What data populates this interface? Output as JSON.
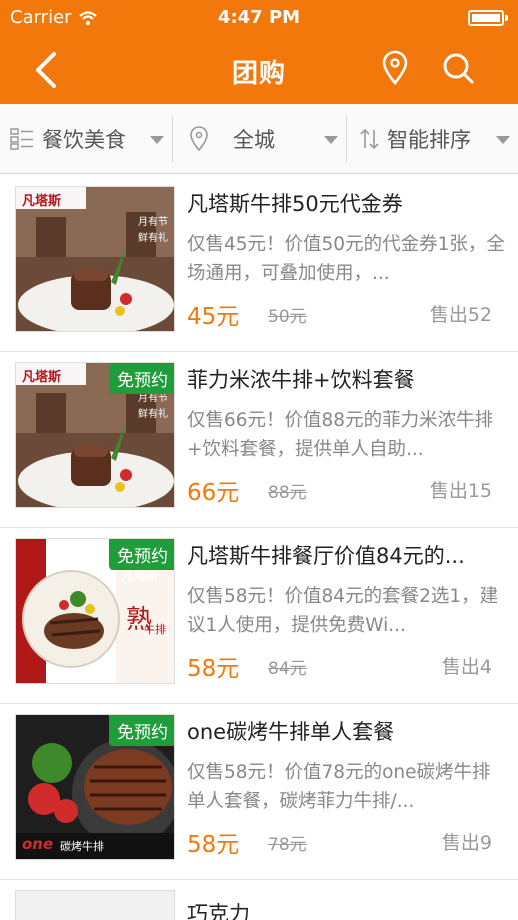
{
  "status": {
    "carrier": "Carrier",
    "time": "4:47 PM"
  },
  "nav": {
    "title": "团购",
    "back_icon": "chevron-left-icon",
    "location_icon": "location-pin-icon",
    "search_icon": "search-icon"
  },
  "filters": [
    {
      "label": "餐饮美食",
      "icon": "grid-icon"
    },
    {
      "label": "全城",
      "icon": "location-pin-icon"
    },
    {
      "label": "智能排序",
      "icon": "sort-icon"
    }
  ],
  "colors": {
    "accent": "#f2780c",
    "badge": "#1f9d3a"
  },
  "items": [
    {
      "title": "凡塔斯牛排50元代金券",
      "desc": "仅售45元！价值50元的代金券1张，全场通用，可叠加使用，...",
      "price": "45元",
      "orig": "50元",
      "sold": "售出52",
      "badge": "",
      "thumb_text": [
        "凡塔斯",
        "月有节",
        "鲜有礼"
      ]
    },
    {
      "title": "菲力米浓牛排+饮料套餐",
      "desc": "仅售66元！价值88元的菲力米浓牛排+饮料套餐，提供单人自助...",
      "price": "66元",
      "orig": "88元",
      "sold": "售出15",
      "badge": "免预约",
      "thumb_text": [
        "凡塔斯",
        "月有节",
        "鲜有礼"
      ]
    },
    {
      "title": "凡塔斯牛排餐厅价值84元的...",
      "desc": "仅售58元！价值84元的套餐2选1，建议1人使用，提供免费Wi...",
      "price": "58元",
      "orig": "84元",
      "sold": "售出4",
      "badge": "免预约",
      "thumb_text": [
        "凡塔斯",
        "熟",
        "牛排"
      ]
    },
    {
      "title": "one碳烤牛排单人套餐",
      "desc": "仅售58元！价值78元的one碳烤牛排单人套餐，碳烤菲力牛排/...",
      "price": "58元",
      "orig": "78元",
      "sold": "售出9",
      "badge": "免预约",
      "thumb_text": [
        "one",
        "碳烤牛排"
      ]
    },
    {
      "title": "巧克力",
      "desc": "",
      "price": "",
      "orig": "",
      "sold": "",
      "badge": "",
      "thumb_text": []
    }
  ]
}
